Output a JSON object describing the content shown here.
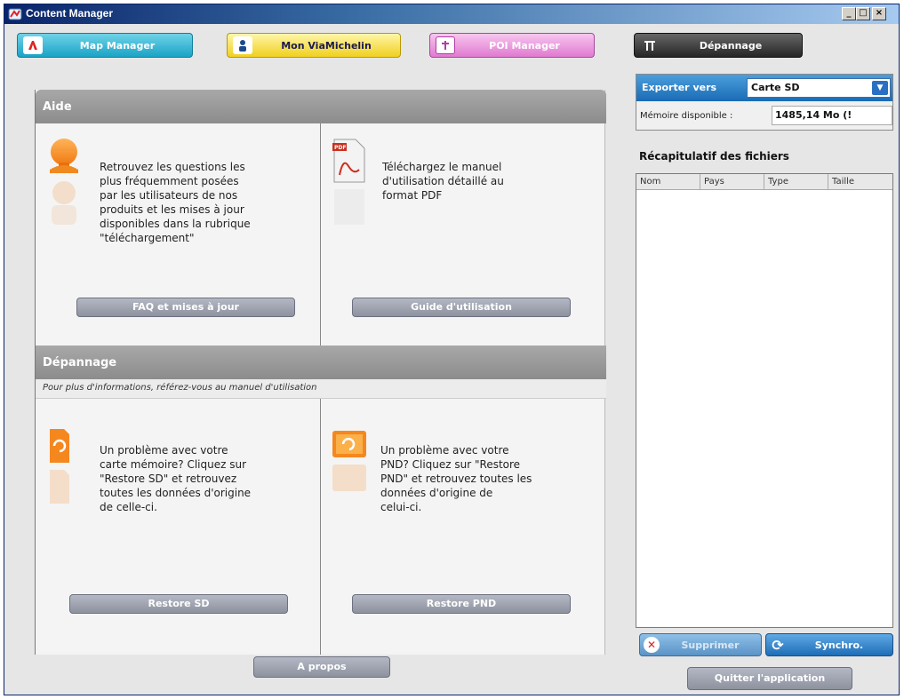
{
  "window": {
    "title": "Content Manager",
    "icon": "app-icon",
    "controls": {
      "minimize": "_",
      "maximize": "□",
      "close": "×"
    }
  },
  "nav": {
    "map_manager": {
      "label": "Map Manager",
      "icon": "map-icon",
      "color": "#1aa3c6"
    },
    "mon_viamichelin": {
      "label": "Mon ViaMichelin",
      "icon": "person-icon",
      "color": "#f0d020"
    },
    "poi_manager": {
      "label": "POI Manager",
      "icon": "poi-icon",
      "color": "#e07ad0"
    },
    "depannage": {
      "label": "Dépannage",
      "icon": "tools-icon",
      "color": "#262626"
    }
  },
  "aide": {
    "title": "Aide",
    "faq": {
      "icon": "help-person-icon",
      "lines": [
        "Retrouvez les questions les",
        "plus fréquemment posées",
        "par les utilisateurs de nos",
        "produits et les mises à jour",
        "disponibles dans la rubrique",
        "\"téléchargement\""
      ],
      "button": "FAQ et mises à jour"
    },
    "guide": {
      "icon": "pdf-icon",
      "lines": [
        "Téléchargez le manuel",
        "d'utilisation détaillé au",
        "format PDF"
      ],
      "button": "Guide d'utilisation"
    }
  },
  "depannage": {
    "title": "Dépannage",
    "subtitle": "Pour plus d'informations, référez-vous au manuel d'utilisation",
    "sd": {
      "icon": "sd-card-restore-icon",
      "lines": [
        "Un problème avec votre",
        "carte mémoire? Cliquez sur",
        "\"Restore SD\" et retrouvez",
        "toutes les données d'origine",
        "de celle-ci."
      ],
      "button": "Restore SD"
    },
    "pnd": {
      "icon": "pnd-restore-icon",
      "lines": [
        "Un problème avec votre",
        "PND? Cliquez sur \"Restore",
        "PND\" et retrouvez toutes les",
        "données d'origine de",
        "celui-ci."
      ],
      "button": "Restore PND"
    }
  },
  "apropos": {
    "label": "A propos"
  },
  "export": {
    "label": "Exporter vers",
    "selected": "Carte SD",
    "memory_label": "Mémoire disponible :",
    "memory_value": "1485,14 Mo (!"
  },
  "recap": {
    "title": "Récapitulatif des fichiers",
    "columns": [
      "Nom",
      "Pays",
      "Type",
      "Taille"
    ]
  },
  "actions": {
    "supprimer": "Supprimer",
    "synchro": "Synchro.",
    "quitter": "Quitter l'application"
  }
}
